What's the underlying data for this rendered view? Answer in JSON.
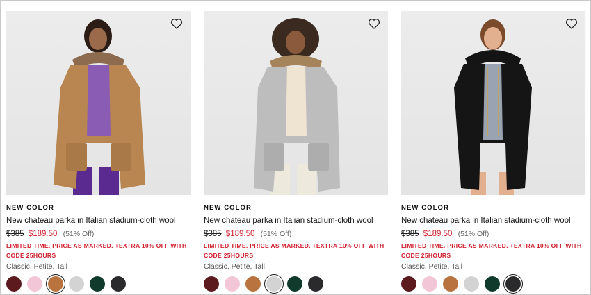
{
  "colors": {
    "sale": "#d0202e",
    "swatches": [
      "#5c1a1f",
      "#f2c6d6",
      "#b8733e",
      "#d3d3d3",
      "#103b2c",
      "#2a2a2d"
    ]
  },
  "products": [
    {
      "badge": "NEW COLOR",
      "title": "New chateau parka in Italian stadium-cloth wool",
      "original_price": "$385",
      "sale_price": "$189.50",
      "discount": "(51% Off)",
      "promo": "LIMITED TIME. PRICE AS MARKED. +EXTRA 10% OFF WITH CODE 25HOURS",
      "sizes": "Classic, Petite, Tall",
      "selected_swatch": 2,
      "coat_color": "#b98651",
      "image_desc": "camel-parka"
    },
    {
      "badge": "NEW COLOR",
      "title": "New chateau parka in Italian stadium-cloth wool",
      "original_price": "$385",
      "sale_price": "$189.50",
      "discount": "(51% Off)",
      "promo": "LIMITED TIME. PRICE AS MARKED. +EXTRA 10% OFF WITH CODE 25HOURS",
      "sizes": "Classic, Petite, Tall",
      "selected_swatch": 3,
      "coat_color": "#bdbdbd",
      "image_desc": "grey-parka"
    },
    {
      "badge": "NEW COLOR",
      "title": "New chateau parka in Italian stadium-cloth wool",
      "original_price": "$385",
      "sale_price": "$189.50",
      "discount": "(51% Off)",
      "promo": "LIMITED TIME. PRICE AS MARKED. +EXTRA 10% OFF WITH CODE 25HOURS",
      "sizes": "Classic, Petite, Tall",
      "selected_swatch": 5,
      "coat_color": "#151515",
      "image_desc": "black-parka"
    }
  ],
  "icons": {
    "favorite": "heart-outline-icon"
  }
}
